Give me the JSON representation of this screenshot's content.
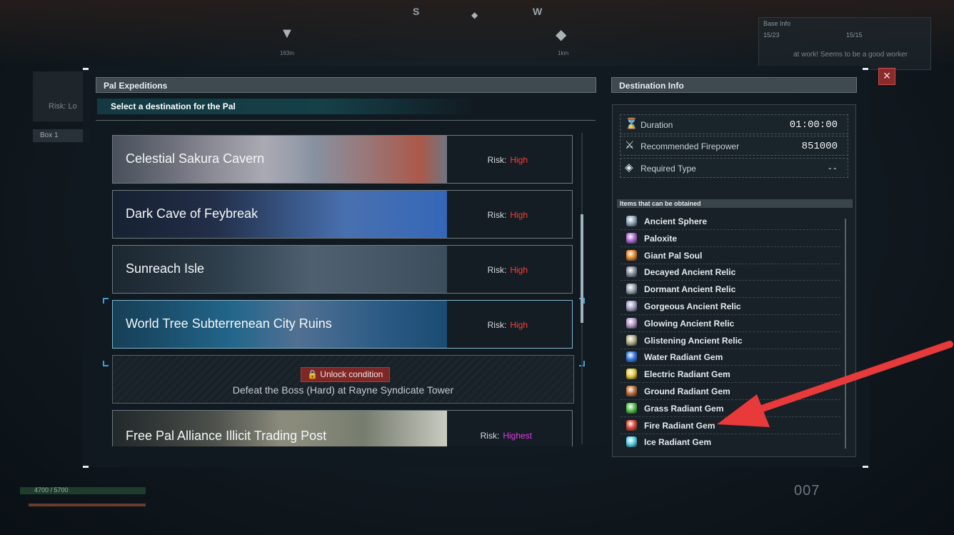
{
  "background": {
    "compass": {
      "s": "S",
      "w": "W",
      "dist1": "163m",
      "dist2": "1km"
    },
    "base_info": {
      "title": "Base Info",
      "a": "15/23",
      "b": "15/15",
      "msg": "at work! Seems to be a good worker"
    },
    "left_risk": "Risk: Lo",
    "box_tab": "Box 1",
    "hp": "4700 / 5700",
    "counter": "007"
  },
  "expeditions": {
    "title": "Pal Expeditions",
    "subtitle": "Select a destination for the Pal",
    "destinations": [
      {
        "name": "Celestial Sakura Cavern",
        "risk_label": "Risk:",
        "risk": "High",
        "risk_color": "#ff3b3b"
      },
      {
        "name": "Dark Cave of Feybreak",
        "risk_label": "Risk:",
        "risk": "High",
        "risk_color": "#ff3b3b"
      },
      {
        "name": "Sunreach Isle",
        "risk_label": "Risk:",
        "risk": "High",
        "risk_color": "#ff3b3b"
      },
      {
        "name": "World Tree Subterrenean City Ruins",
        "risk_label": "Risk:",
        "risk": "High",
        "risk_color": "#ff3b3b"
      },
      {
        "name": "Free Pal Alliance Illicit Trading Post",
        "risk_label": "Risk:",
        "risk": "Highest",
        "risk_color": "#e23be6"
      }
    ],
    "locked": {
      "badge": "Unlock condition",
      "condition": "Defeat the Boss (Hard) at Rayne Syndicate Tower"
    }
  },
  "destination_info": {
    "title": "Destination Info",
    "stats": [
      {
        "icon": "hourglass-icon",
        "label": "Duration",
        "value": "01:00:00"
      },
      {
        "icon": "crossed-swords-icon",
        "label": "Recommended Firepower",
        "value": "851000"
      },
      {
        "icon": "diamond-type-icon",
        "label": "Required Type",
        "value": "--"
      }
    ],
    "items_title": "Items that can be obtained",
    "items": [
      {
        "name": "Ancient Sphere",
        "color": "#8fa7b8"
      },
      {
        "name": "Paloxite",
        "color": "#b06ad6"
      },
      {
        "name": "Giant Pal Soul",
        "color": "#e88a2a"
      },
      {
        "name": "Decayed Ancient Relic",
        "color": "#8a8f9e"
      },
      {
        "name": "Dormant Ancient Relic",
        "color": "#9aa3ad"
      },
      {
        "name": "Gorgeous Ancient Relic",
        "color": "#a7a1c6"
      },
      {
        "name": "Glowing Ancient Relic",
        "color": "#b59ac4"
      },
      {
        "name": "Glistening Ancient Relic",
        "color": "#b7b08a"
      },
      {
        "name": "Water Radiant Gem",
        "color": "#3a7bea"
      },
      {
        "name": "Electric Radiant Gem",
        "color": "#e8c93a"
      },
      {
        "name": "Ground Radiant Gem",
        "color": "#c2703a"
      },
      {
        "name": "Grass Radiant Gem",
        "color": "#5ac24a"
      },
      {
        "name": "Fire Radiant Gem",
        "color": "#e04a3a"
      },
      {
        "name": "Ice Radiant Gem",
        "color": "#5ad1e8"
      }
    ]
  },
  "colors": {
    "accent": "#3f9fd1",
    "arrow": "#e8393b"
  }
}
